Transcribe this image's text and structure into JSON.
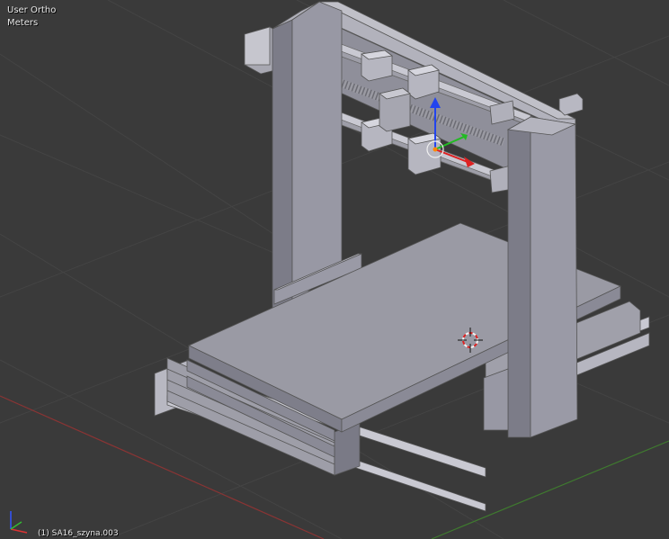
{
  "viewport": {
    "view_name": "User Ortho",
    "units": "Meters",
    "object_name": "(1) SA16_szyna.003"
  },
  "colors": {
    "background": "#3a3a3a",
    "grid": "#434343",
    "axis_x": "#8a3434",
    "axis_y": "#3f7a2f",
    "mesh_light": "#a4a4ae",
    "mesh_mid": "#8e8e98",
    "mesh_dark": "#747480",
    "manip_z": "#2244ee",
    "manip_x": "#dd2222",
    "manip_y": "#22bb22"
  },
  "icons": [
    "3d-cursor-icon",
    "transform-manipulator-icon",
    "axis-orientation-gizmo-icon"
  ]
}
